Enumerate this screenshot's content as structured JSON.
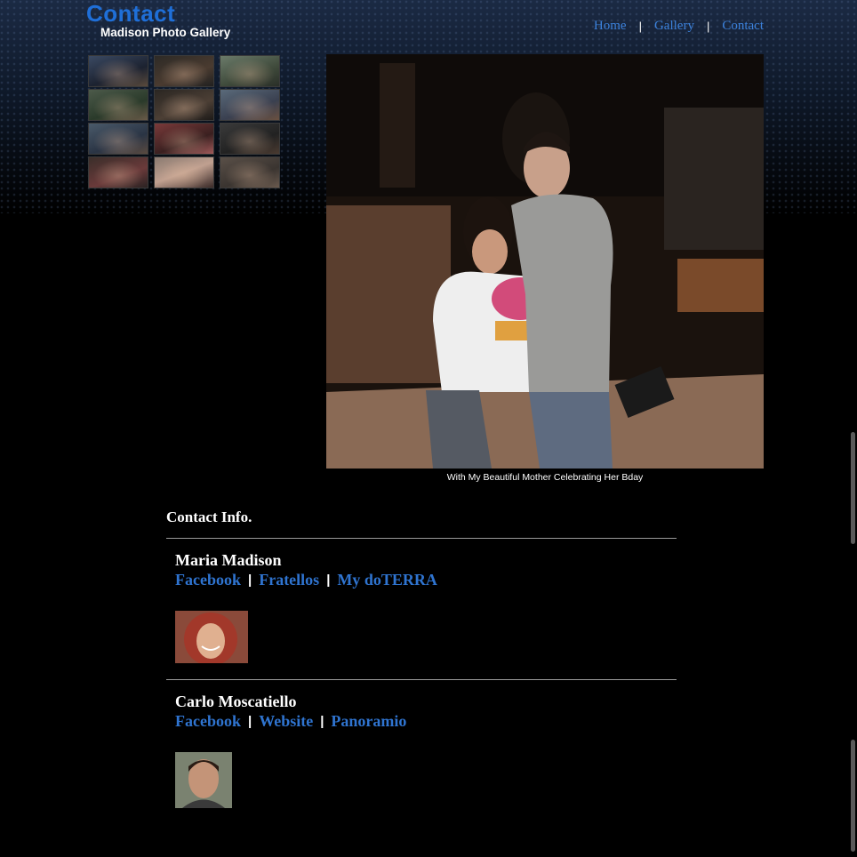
{
  "header": {
    "title": "Contact",
    "subtitle": "Madison Photo Gallery"
  },
  "nav": {
    "items": [
      {
        "label": "Home"
      },
      {
        "label": "Gallery"
      },
      {
        "label": "Contact"
      }
    ],
    "separator": "|"
  },
  "gallery": {
    "thumbnail_count": 12,
    "caption": "With My Beautiful Mother Celebrating Her Bday"
  },
  "contact": {
    "heading": "Contact Info.",
    "separator": "|",
    "people": [
      {
        "name": "Maria Madison",
        "links": [
          "Facebook",
          "Fratellos",
          "My doTERRA"
        ]
      },
      {
        "name": "Carlo Moscatiello",
        "links": [
          "Facebook",
          "Website",
          "Panoramio"
        ]
      }
    ]
  },
  "colors": {
    "title_blue": "#1f6fd8",
    "link_blue": "#2f74d0",
    "background": "#000000",
    "text": "#ffffff"
  }
}
